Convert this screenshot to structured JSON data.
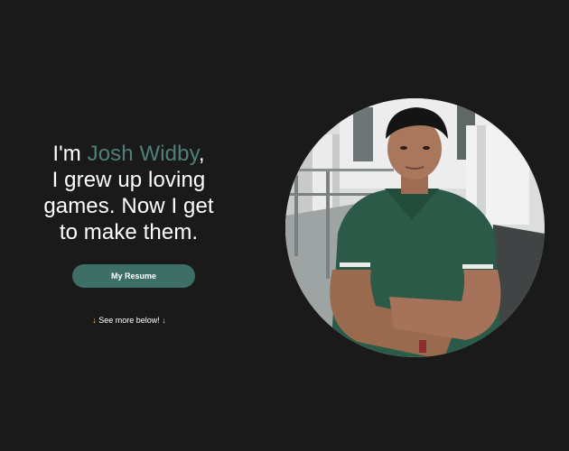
{
  "hero": {
    "intro_prefix": "I'm ",
    "name": "Josh Widby",
    "intro_line1_suffix": ",",
    "intro_line2": "I grew up loving",
    "intro_line3": "games. Now I get",
    "intro_line4": "to make them.",
    "resume_button_label": "My Resume",
    "see_more_arrow_left": "↓",
    "see_more_text": " See more below! ",
    "see_more_arrow_right": "↓"
  },
  "colors": {
    "background": "#1a1a1a",
    "accent": "#4f8077",
    "button": "#3e6f67",
    "arrow": "#f2d44a"
  }
}
